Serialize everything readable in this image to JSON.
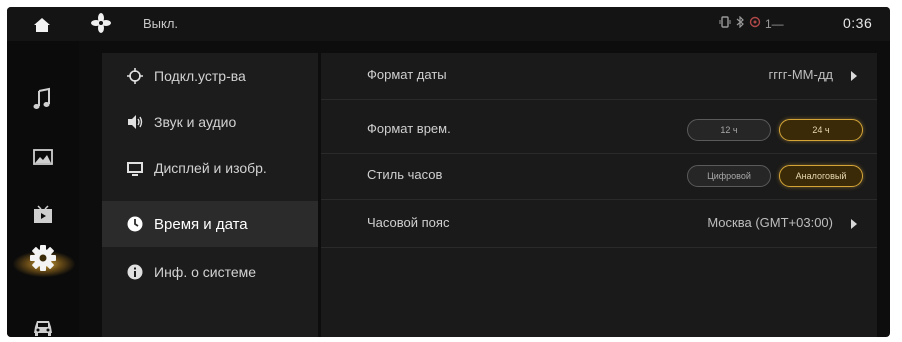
{
  "statusbar": {
    "climate_status": "Выкл.",
    "indicator_text": "1—",
    "time": "0:36"
  },
  "rail": {
    "items": [
      {
        "icon": "music-note-icon"
      },
      {
        "icon": "gallery-icon"
      },
      {
        "icon": "video-icon"
      },
      {
        "icon": "gear-icon",
        "active": true
      },
      {
        "icon": "car-icon"
      }
    ]
  },
  "categories": [
    {
      "label": "Подкл.устр-ва",
      "icon": "device-connect-icon"
    },
    {
      "label": "Звук и аудио",
      "icon": "speaker-icon"
    },
    {
      "label": "Дисплей и изобр.",
      "icon": "display-icon"
    },
    {
      "label": "Время и дата",
      "icon": "clock-icon",
      "active": true
    },
    {
      "label": "Инф. о системе",
      "icon": "info-icon"
    }
  ],
  "settings": {
    "date_format": {
      "label": "Формат даты",
      "value": "гггг-ММ-дд"
    },
    "time_format": {
      "label": "Формат врем.",
      "options": [
        "12 ч",
        "24 ч"
      ],
      "selected": "24 ч"
    },
    "clock_style": {
      "label": "Стиль часов",
      "options": [
        "Цифровой",
        "Аналоговый"
      ],
      "selected": "Аналоговый"
    },
    "timezone": {
      "label": "Часовой пояс",
      "value": "Москва (GMT+03:00)"
    }
  },
  "colors": {
    "accent": "#d4a437",
    "background": "#0d0d0d",
    "panel": "#1c1c1c",
    "active_item": "#2b2b2b"
  }
}
